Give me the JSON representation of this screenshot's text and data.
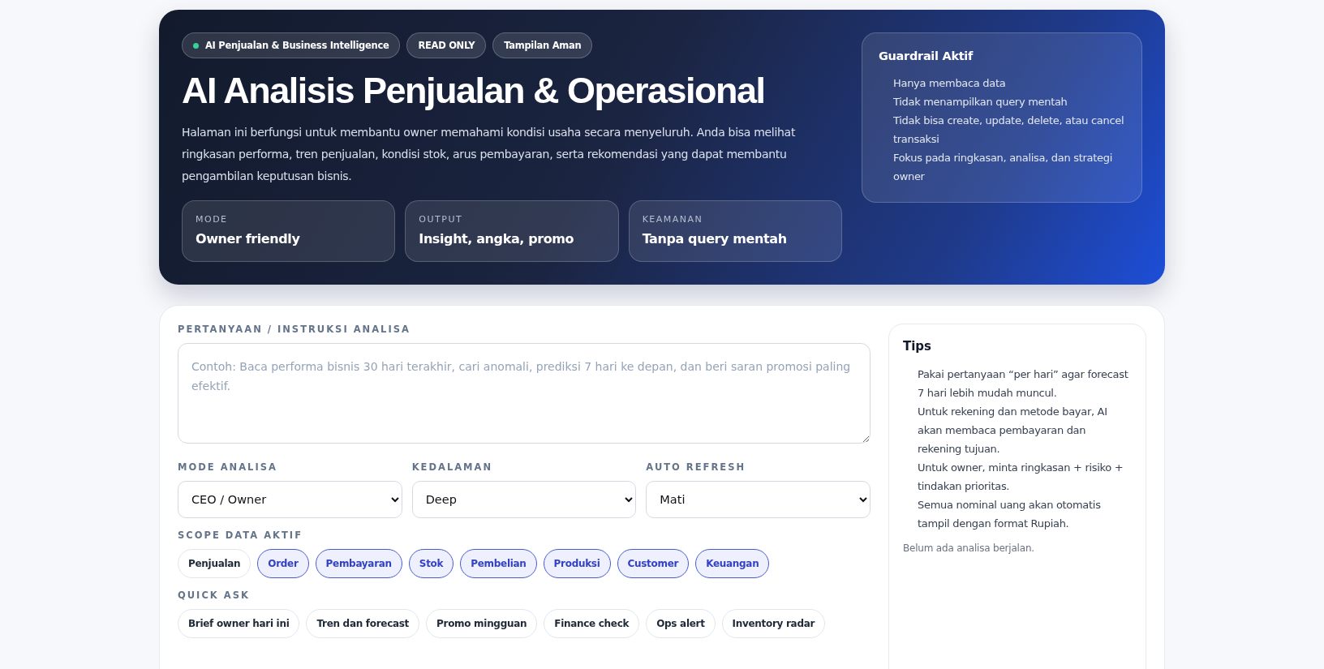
{
  "hero": {
    "badges": [
      {
        "label": "AI Penjualan & Business Intelligence",
        "kind": "status"
      },
      {
        "label": "READ ONLY",
        "kind": "plain"
      },
      {
        "label": "Tampilan Aman",
        "kind": "plain"
      }
    ],
    "title": "AI Analisis Penjualan & Operasional",
    "description": "Halaman ini berfungsi untuk membantu owner memahami kondisi usaha secara menyeluruh. Anda bisa melihat ringkasan performa, tren penjualan, kondisi stok, arus pembayaran, serta rekomendasi yang dapat membantu pengambilan keputusan bisnis.",
    "stats": [
      {
        "label": "MODE",
        "value": "Owner friendly"
      },
      {
        "label": "OUTPUT",
        "value": "Insight, angka, promo"
      },
      {
        "label": "KEAMANAN",
        "value": "Tanpa query mentah"
      }
    ],
    "guardrail": {
      "title": "Guardrail Aktif",
      "items": [
        "Hanya membaca data",
        "Tidak menampilkan query mentah",
        "Tidak bisa create, update, delete, atau cancel transaksi",
        "Fokus pada ringkasan, analisa, dan strategi owner"
      ]
    }
  },
  "form": {
    "question": {
      "label": "PERTANYAAN / INSTRUKSI ANALISA",
      "placeholder": "Contoh: Baca performa bisnis 30 hari terakhir, cari anomali, prediksi 7 hari ke depan, dan beri saran promosi paling efektif."
    },
    "selects": [
      {
        "label": "MODE ANALISA",
        "value": "CEO / Owner"
      },
      {
        "label": "KEDALAMAN",
        "value": "Deep"
      },
      {
        "label": "AUTO REFRESH",
        "value": "Mati"
      }
    ],
    "scope": {
      "label": "SCOPE DATA AKTIF",
      "chips": [
        {
          "label": "Penjualan",
          "selected": false
        },
        {
          "label": "Order",
          "selected": true
        },
        {
          "label": "Pembayaran",
          "selected": true
        },
        {
          "label": "Stok",
          "selected": true
        },
        {
          "label": "Pembelian",
          "selected": true
        },
        {
          "label": "Produksi",
          "selected": true
        },
        {
          "label": "Customer",
          "selected": true
        },
        {
          "label": "Keuangan",
          "selected": true
        }
      ]
    },
    "quick_ask": {
      "label": "QUICK ASK",
      "buttons": [
        "Brief owner hari ini",
        "Tren dan forecast",
        "Promo mingguan",
        "Finance check",
        "Ops alert",
        "Inventory radar"
      ]
    }
  },
  "tips": {
    "title": "Tips",
    "items": [
      "Pakai pertanyaan “per hari” agar forecast 7 hari lebih mudah muncul.",
      "Untuk rekening dan metode bayar, AI akan membaca pembayaran dan rekening tujuan.",
      "Untuk owner, minta ringkasan + risiko + tindakan prioritas.",
      "Semua nominal uang akan otomatis tampil dengan format Rupiah."
    ],
    "status": "Belum ada analisa berjalan."
  }
}
